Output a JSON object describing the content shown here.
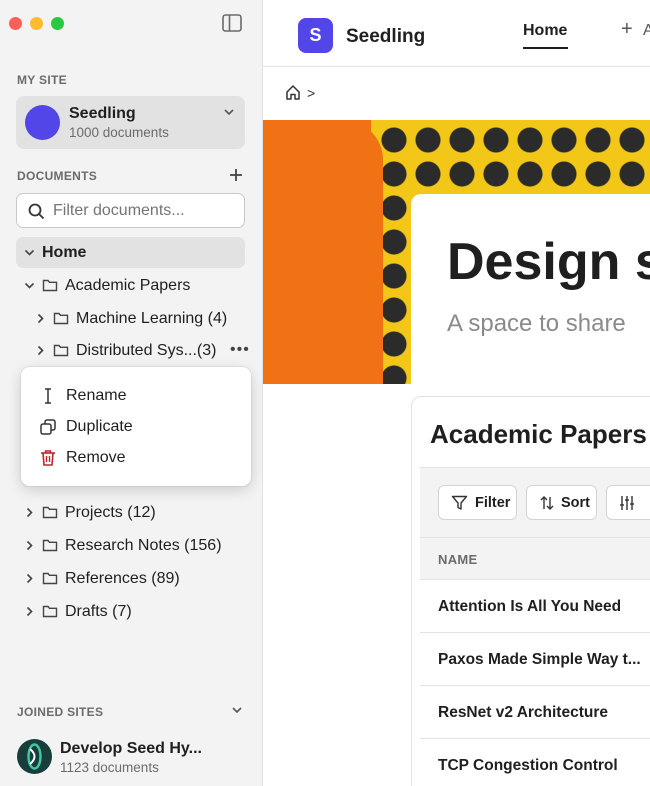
{
  "sidebar": {
    "my_site_label": "MY SITE",
    "site": {
      "name": "Seedling",
      "count": "1000 documents"
    },
    "documents_label": "DOCUMENTS",
    "filter_placeholder": "Filter documents...",
    "tree": [
      {
        "label": "Home"
      },
      {
        "label": "Academic Papers"
      },
      {
        "label": "Machine Learning (4)"
      },
      {
        "label": "Distributed Sys...(3)"
      },
      {
        "label": "Projects (12)"
      },
      {
        "label": "Research Notes (156)"
      },
      {
        "label": "References (89)"
      },
      {
        "label": "Drafts (7)"
      }
    ],
    "context_menu": {
      "rename": "Rename",
      "duplicate": "Duplicate",
      "remove": "Remove"
    },
    "joined_label": "JOINED SITES",
    "joined_site": {
      "name": "Develop Seed Hy...",
      "count": "1123 documents"
    }
  },
  "header": {
    "brand_letter": "S",
    "brand_name": "Seedling",
    "tab_home": "Home",
    "tab_add_text": "A",
    "breadcrumb_sep": ">"
  },
  "hero": {
    "title": "Design s",
    "subtitle": "A space to share"
  },
  "panel": {
    "title": "Academic Papers",
    "filter_label": "Filter",
    "sort_label": "Sort",
    "column_name": "NAME",
    "rows": [
      "Attention Is All You Need",
      "Paxos Made Simple Way t...",
      "ResNet v2 Architecture",
      "TCP Congestion Control"
    ]
  },
  "colors": {
    "accent": "#5246e8",
    "hero_orange": "#f07214",
    "hero_yellow": "#f2c718",
    "danger": "#c0262d"
  }
}
